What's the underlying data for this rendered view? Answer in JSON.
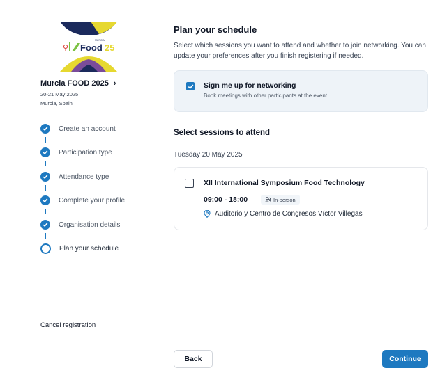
{
  "event": {
    "logo_text": "Food 25",
    "logo_tagline": "MURCIA",
    "name": "Murcia FOOD 2025",
    "chevron_icon": "chevron-right-icon",
    "dates": "20-21 May 2025",
    "location": "Murcia, Spain"
  },
  "steps": [
    {
      "label": "Create an account",
      "status": "complete",
      "icon": "check-icon"
    },
    {
      "label": "Participation type",
      "status": "complete",
      "icon": "check-icon"
    },
    {
      "label": "Attendance type",
      "status": "complete",
      "icon": "check-icon"
    },
    {
      "label": "Complete your profile",
      "status": "complete",
      "icon": "check-icon"
    },
    {
      "label": "Organisation details",
      "status": "complete",
      "icon": "check-icon"
    },
    {
      "label": "Plan your schedule",
      "status": "current",
      "icon": "ring-icon"
    }
  ],
  "cancel_label": "Cancel registration",
  "main": {
    "title": "Plan your schedule",
    "subtitle": "Select which sessions you want to attend and whether to join networking. You can update your preferences after you finish registering if needed.",
    "networking": {
      "checked": true,
      "title": "Sign me up for networking",
      "description": "Book meetings with other participants at the event."
    },
    "sessions_title": "Select sessions to attend",
    "day_label": "Tuesday 20 May 2025",
    "session": {
      "checked": false,
      "title": "XII International Symposium Food Technology",
      "time": "09:00 - 18:00",
      "badge_icon": "people-icon",
      "badge": "In-person",
      "venue_icon": "location-pin-icon",
      "venue": "Auditorio y Centro de Congresos Víctor Villegas"
    }
  },
  "footer": {
    "back_label": "Back",
    "continue_label": "Continue"
  },
  "colors": {
    "accent": "#1e79c0",
    "card_bg": "#eef3f8",
    "logo_navy": "#1b2a5c",
    "logo_yellow": "#e6d830",
    "logo_purple": "#7a4c9a",
    "logo_green": "#7cc243",
    "logo_red": "#d9342b"
  }
}
